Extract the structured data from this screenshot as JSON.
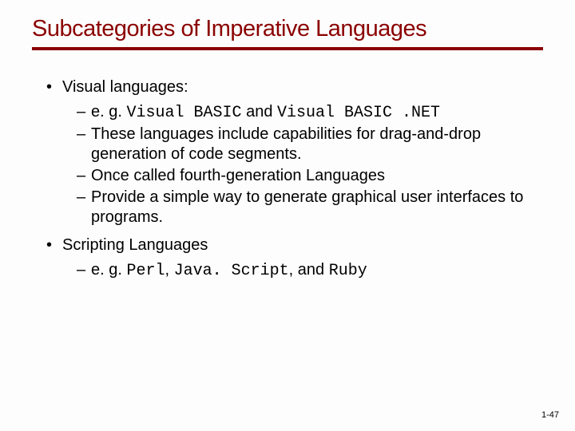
{
  "title": "Subcategories of Imperative Languages",
  "b1": {
    "heading": "Visual languages:",
    "s1": {
      "pre": "e. g. ",
      "c1": "Visual BASIC",
      "mid": " and ",
      "c2": "Visual BASIC .NET"
    },
    "s2": "These languages include capabilities for drag-and-drop generation of code segments.",
    "s3": "Once called fourth-generation Languages",
    "s4": "Provide a simple way to generate graphical user interfaces to programs."
  },
  "b2": {
    "heading": "Scripting Languages",
    "s1": {
      "pre": "e. g. ",
      "c1": "Perl",
      "sep1": ", ",
      "c2": "Java. Script",
      "sep2": ", and ",
      "c3": "Ruby"
    }
  },
  "page": "1-47"
}
